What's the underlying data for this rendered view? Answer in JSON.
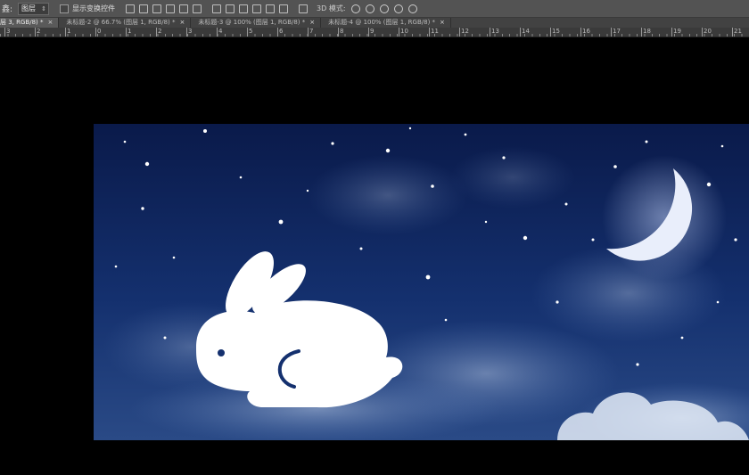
{
  "options": {
    "label_prefix": "鑫:",
    "auto_select_value": "图层",
    "show_transform_label": "显示变换控件",
    "mode_label": "3D 模式:"
  },
  "tabs": [
    {
      "label": "层 3, RGB/8) *",
      "active": true
    },
    {
      "label": "未标题-2 @ 66.7% (图层 1, RGB/8) *",
      "active": false
    },
    {
      "label": "未标题-3 @ 100% (图层 1, RGB/8) *",
      "active": false
    },
    {
      "label": "未标题-4 @ 100% (图层 1, RGB/8) *",
      "active": false
    }
  ],
  "tab_close_glyph": "×",
  "ruler_ticks": [
    "3",
    "2",
    "1",
    "0",
    "1",
    "2",
    "3",
    "4",
    "5",
    "6",
    "7",
    "8",
    "9",
    "10",
    "11",
    "12",
    "13",
    "14",
    "15",
    "16",
    "17",
    "18",
    "19",
    "20",
    "21"
  ]
}
